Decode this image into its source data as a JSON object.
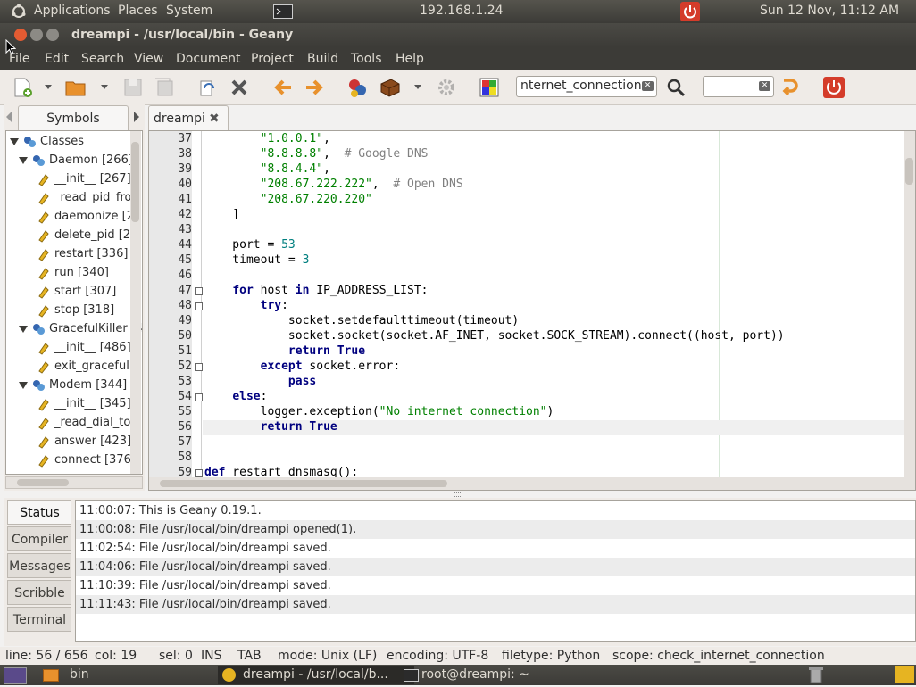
{
  "top_panel": {
    "applications": "Applications",
    "places": "Places",
    "system": "System",
    "ip": "192.168.1.24",
    "clock": "Sun 12 Nov, 11:12 AM"
  },
  "window": {
    "title": "dreampi - /usr/local/bin - Geany"
  },
  "menu": [
    "File",
    "Edit",
    "Search",
    "View",
    "Document",
    "Project",
    "Build",
    "Tools",
    "Help"
  ],
  "toolbar": {
    "search_value": "nternet_connection",
    "goto_value": ""
  },
  "sidebar": {
    "tab_label": "Symbols",
    "tree": [
      {
        "label": "Classes",
        "type": "root"
      },
      {
        "label": "Daemon [266]",
        "type": "class"
      },
      {
        "label": "__init__ [267]",
        "type": "fn"
      },
      {
        "label": "_read_pid_fro",
        "type": "fn"
      },
      {
        "label": "daemonize [2",
        "type": "fn"
      },
      {
        "label": "delete_pid [2",
        "type": "fn"
      },
      {
        "label": "restart [336]",
        "type": "fn"
      },
      {
        "label": "run [340]",
        "type": "fn"
      },
      {
        "label": "start [307]",
        "type": "fn"
      },
      {
        "label": "stop [318]",
        "type": "fn"
      },
      {
        "label": "GracefulKiller [4",
        "type": "class"
      },
      {
        "label": "__init__ [486]",
        "type": "fn"
      },
      {
        "label": "exit_gracefull",
        "type": "fn"
      },
      {
        "label": "Modem [344]",
        "type": "class"
      },
      {
        "label": "__init__ [345]",
        "type": "fn"
      },
      {
        "label": "_read_dial_to",
        "type": "fn"
      },
      {
        "label": "answer [423]",
        "type": "fn"
      },
      {
        "label": "connect [376",
        "type": "fn"
      }
    ]
  },
  "editor": {
    "tab_label": "dreampi",
    "lines": [
      {
        "n": "37",
        "code": "        \"1.0.0.1\","
      },
      {
        "n": "38",
        "code": "        \"8.8.8.8\",  # Google DNS"
      },
      {
        "n": "39",
        "code": "        \"8.8.4.4\","
      },
      {
        "n": "40",
        "code": "        \"208.67.222.222\",  # Open DNS"
      },
      {
        "n": "41",
        "code": "        \"208.67.220.220\""
      },
      {
        "n": "42",
        "code": "    ]"
      },
      {
        "n": "43",
        "code": ""
      },
      {
        "n": "44",
        "code": "    port = 53"
      },
      {
        "n": "45",
        "code": "    timeout = 3"
      },
      {
        "n": "46",
        "code": ""
      },
      {
        "n": "47",
        "code": "    for host in IP_ADDRESS_LIST:"
      },
      {
        "n": "48",
        "code": "        try:"
      },
      {
        "n": "49",
        "code": "            socket.setdefaulttimeout(timeout)"
      },
      {
        "n": "50",
        "code": "            socket.socket(socket.AF_INET, socket.SOCK_STREAM).connect((host, port))"
      },
      {
        "n": "51",
        "code": "            return True"
      },
      {
        "n": "52",
        "code": "        except socket.error:"
      },
      {
        "n": "53",
        "code": "            pass"
      },
      {
        "n": "54",
        "code": "    else:"
      },
      {
        "n": "55",
        "code": "        logger.exception(\"No internet connection\")"
      },
      {
        "n": "56",
        "code": "        return True"
      },
      {
        "n": "57",
        "code": ""
      },
      {
        "n": "58",
        "code": ""
      },
      {
        "n": "59",
        "code": "def restart_dnsmasq():"
      }
    ]
  },
  "messages": {
    "tabs": [
      "Status",
      "Compiler",
      "Messages",
      "Scribble",
      "Terminal"
    ],
    "active_tab": "Status",
    "rows": [
      "11:00:07: This is Geany 0.19.1.",
      "11:00:08: File /usr/local/bin/dreampi opened(1).",
      "11:02:54: File /usr/local/bin/dreampi saved.",
      "11:04:06: File /usr/local/bin/dreampi saved.",
      "11:10:39: File /usr/local/bin/dreampi saved.",
      "11:11:43: File /usr/local/bin/dreampi saved."
    ]
  },
  "status": {
    "line": "line: 56 / 656",
    "col": "col: 19",
    "sel": "sel: 0",
    "ins": "INS",
    "tab": "TAB",
    "mode": "mode: Unix (LF)",
    "encoding": "encoding: UTF-8",
    "filetype": "filetype: Python",
    "scope": "scope: check_internet_connection"
  },
  "taskbar": {
    "items": [
      "bin",
      "dreampi - /usr/local/b...",
      "root@dreampi: ~"
    ]
  }
}
